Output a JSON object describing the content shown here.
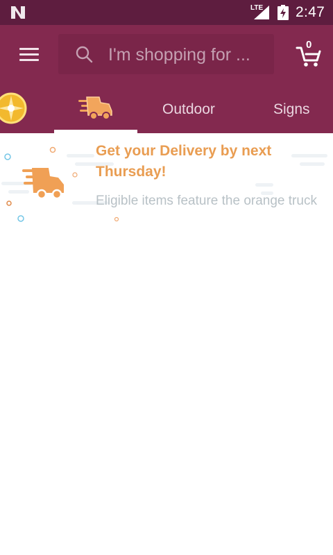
{
  "status_bar": {
    "network": "LTE",
    "time": "2:47"
  },
  "header": {
    "search_placeholder": "I'm shopping for ...",
    "cart_count": "0"
  },
  "tabs": [
    {
      "label": "",
      "icon": "gold-badge-icon",
      "selected": false
    },
    {
      "label": "",
      "icon": "delivery-truck-icon",
      "selected": true
    },
    {
      "label": "Outdoor",
      "selected": false
    },
    {
      "label": "Signs",
      "selected": false
    }
  ],
  "banner": {
    "headline": "Get your Delivery by next Thursday!",
    "subtext": "Eligible items feature the orange truck",
    "icon": "delivery-truck-icon"
  },
  "colors": {
    "status_bar": "#5e1d3f",
    "app_bar": "#83294f",
    "accent_orange": "#e99d52",
    "subtext_gray": "#b8c1c6"
  }
}
